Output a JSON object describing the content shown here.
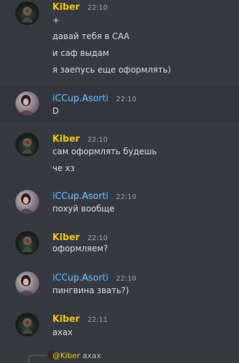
{
  "users": {
    "kiber": {
      "name": "Kiber",
      "color": "#f1c40f"
    },
    "iccup": {
      "name": "iCCup.Asorti",
      "color": "#6ab8ee"
    }
  },
  "messages": [
    {
      "author": "Kiber",
      "time": "22:10",
      "lines": [
        "+",
        "давай тебя в САА",
        "и саф выдам",
        "я заепусь еще оформлять)"
      ]
    },
    {
      "author": "iCCup.Asorti",
      "time": "22:10",
      "lines": [
        "D"
      ]
    },
    {
      "author": "Kiber",
      "time": "22:10",
      "lines": [
        "сам оформлять будешь",
        "че хз"
      ]
    },
    {
      "author": "iCCup.Asorti",
      "time": "22:10",
      "lines": [
        "похуй вообще"
      ]
    },
    {
      "author": "Kiber",
      "time": "22:10",
      "lines": [
        "оформляем?"
      ]
    },
    {
      "author": "iCCup.Asorti",
      "time": "22:10",
      "lines": [
        "пингвина звать?)"
      ]
    },
    {
      "author": "Kiber",
      "time": "22:11",
      "lines": [
        "ахах"
      ]
    }
  ],
  "reply_preview": {
    "mention": "@Kiber",
    "text": "ахах"
  },
  "background_color": "#36393f"
}
